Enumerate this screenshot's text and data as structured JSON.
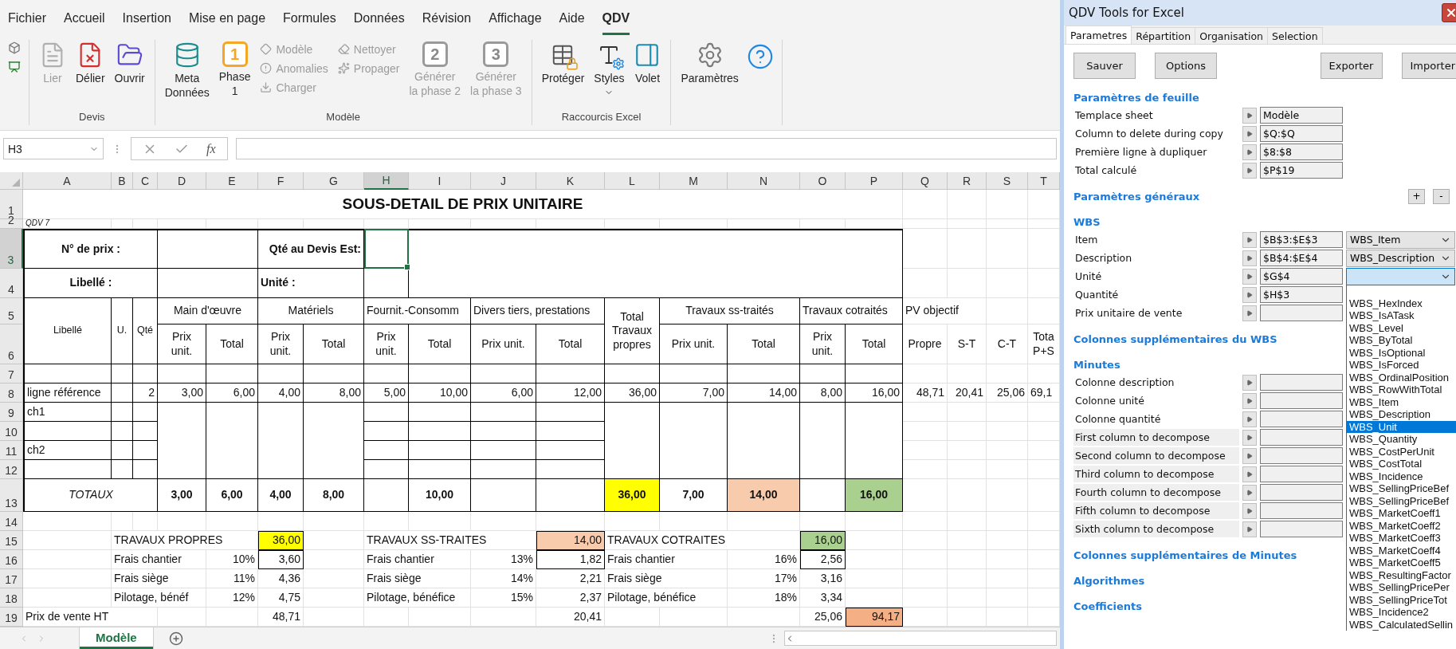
{
  "ribbon": {
    "tabs": [
      {
        "label": "Fichier",
        "selected": false
      },
      {
        "label": "Accueil",
        "selected": false
      },
      {
        "label": "Insertion",
        "selected": false
      },
      {
        "label": "Mise en page",
        "selected": false
      },
      {
        "label": "Formules",
        "selected": false
      },
      {
        "label": "Données",
        "selected": false
      },
      {
        "label": "Révision",
        "selected": false
      },
      {
        "label": "Affichage",
        "selected": false
      },
      {
        "label": "Aide",
        "selected": false
      },
      {
        "label": "QDV",
        "selected": true
      }
    ],
    "groups": [
      {
        "buttons": [
          {
            "kind": "tiny"
          },
          {
            "kind": "tiny"
          }
        ]
      },
      {
        "label": "Devis",
        "buttons": [
          {
            "kind": "large",
            "label": "Lier",
            "disabled": true
          },
          {
            "kind": "large",
            "label": "Délier",
            "disabled": false
          },
          {
            "kind": "large",
            "label": "Ouvrir",
            "disabled": false
          }
        ]
      },
      {
        "label": "Modèle",
        "buttons": [
          {
            "kind": "large",
            "label": "Meta\nDonnées",
            "disabled": false
          },
          {
            "kind": "numbered",
            "badge": "1",
            "label": "Phase\n1",
            "disabled": false
          },
          {
            "kind": "stack",
            "items": [
              {
                "label": "Modèle",
                "disabled": true
              },
              {
                "label": "Anomalies",
                "disabled": true
              },
              {
                "label": "Charger",
                "disabled": true
              }
            ]
          },
          {
            "kind": "stack",
            "items": [
              {
                "label": "Nettoyer",
                "disabled": true
              },
              {
                "label": "Propager",
                "disabled": true
              }
            ]
          },
          {
            "kind": "numbered",
            "badge": "2",
            "label": "Générer\nla phase 2",
            "disabled": true
          },
          {
            "kind": "numbered",
            "badge": "3",
            "label": "Générer\nla phase 3",
            "disabled": true
          }
        ]
      },
      {
        "label": "Raccourcis Excel",
        "buttons": [
          {
            "kind": "large",
            "label": "Protéger",
            "disabled": false
          },
          {
            "kind": "menu",
            "label": "Styles",
            "disabled": false
          },
          {
            "kind": "large",
            "label": "Volet",
            "disabled": false
          }
        ]
      },
      {
        "buttons": [
          {
            "kind": "large",
            "label": "Paramètres",
            "disabled": false
          },
          {
            "kind": "icon",
            "disabled": false
          }
        ]
      }
    ]
  },
  "formula_bar": {
    "name_box": "H3",
    "function_label": "fx"
  },
  "sheet": {
    "columns": [
      {
        "label": "A",
        "selected": false
      },
      {
        "label": "B",
        "selected": false
      },
      {
        "label": "C",
        "selected": false
      },
      {
        "label": "D",
        "selected": false
      },
      {
        "label": "E",
        "selected": false
      },
      {
        "label": "F",
        "selected": false
      },
      {
        "label": "G",
        "selected": false
      },
      {
        "label": "H",
        "selected": true
      },
      {
        "label": "I",
        "selected": false
      },
      {
        "label": "J",
        "selected": false
      },
      {
        "label": "K",
        "selected": false
      },
      {
        "label": "L",
        "selected": false
      },
      {
        "label": "M",
        "selected": false
      },
      {
        "label": "N",
        "selected": false
      },
      {
        "label": "O",
        "selected": false
      },
      {
        "label": "P",
        "selected": false
      },
      {
        "label": "Q",
        "selected": false
      },
      {
        "label": "R",
        "selected": false
      },
      {
        "label": "S",
        "selected": false
      },
      {
        "label": "T",
        "selected": false
      }
    ],
    "rows": [
      {
        "label": "1",
        "selected": false,
        "cells": [
          {
            "text": "SOUS-DETAIL DE PRIX UNITAIRE"
          }
        ]
      },
      {
        "label": "2",
        "selected": false,
        "cells": [
          {
            "text": "QDV 7"
          }
        ]
      },
      {
        "label": "3",
        "selected": true,
        "cells": [
          {
            "text": "N° de prix :"
          },
          {
            "text": "Qté au Devis Est:"
          }
        ]
      },
      {
        "label": "4",
        "selected": false,
        "cells": [
          {
            "text": "Libellé :"
          },
          {
            "text": "Unité :"
          }
        ]
      },
      {
        "label": "5",
        "selected": false,
        "cells": [
          {
            "text": "Libellé"
          },
          {
            "text": "U."
          },
          {
            "text": "Qté"
          },
          {
            "text": "Main d'œuvre"
          },
          {
            "text": "Matériels"
          },
          {
            "text": "Fournit.-Consomm"
          },
          {
            "text": "Divers tiers, prestations"
          },
          {
            "text": "Total Travaux propres"
          },
          {
            "text": "Travaux ss-traités"
          },
          {
            "text": "Travaux cotraités"
          },
          {
            "text": "PV objectif"
          }
        ]
      },
      {
        "label": "6",
        "selected": false,
        "cells": [
          {
            "text": "Prix unit."
          },
          {
            "text": "Total"
          },
          {
            "text": "Prix unit."
          },
          {
            "text": "Total"
          },
          {
            "text": "Prix unit."
          },
          {
            "text": "Total"
          },
          {
            "text": "Prix unit."
          },
          {
            "text": "Total"
          },
          {
            "text": "Prix unit."
          },
          {
            "text": "Total"
          },
          {
            "text": "Prix unit."
          },
          {
            "text": "Total"
          },
          {
            "text": "Propre"
          },
          {
            "text": "S-T"
          },
          {
            "text": "C-T"
          },
          {
            "text": "Tota P+S"
          }
        ]
      },
      {
        "label": "7",
        "selected": false
      },
      {
        "label": "8",
        "selected": false,
        "cells": [
          {
            "text": "ligne référence"
          },
          {
            "text": "2"
          },
          {
            "text": "3,00"
          },
          {
            "text": "6,00"
          },
          {
            "text": "4,00"
          },
          {
            "text": "8,00"
          },
          {
            "text": "5,00"
          },
          {
            "text": "10,00"
          },
          {
            "text": "6,00"
          },
          {
            "text": "12,00"
          },
          {
            "text": "36,00"
          },
          {
            "text": "7,00"
          },
          {
            "text": "14,00"
          },
          {
            "text": "8,00"
          },
          {
            "text": "16,00"
          },
          {
            "text": "48,71"
          },
          {
            "text": "20,41"
          },
          {
            "text": "25,06"
          },
          {
            "text": "69,1"
          }
        ]
      },
      {
        "label": "9",
        "selected": false,
        "cells": [
          {
            "text": "ch1"
          }
        ]
      },
      {
        "label": "10",
        "selected": false
      },
      {
        "label": "11",
        "selected": false,
        "cells": [
          {
            "text": "ch2"
          }
        ]
      },
      {
        "label": "12",
        "selected": false
      },
      {
        "label": "13",
        "selected": false,
        "cells": [
          {
            "text": "TOTAUX"
          },
          {
            "text": "3,00"
          },
          {
            "text": "6,00"
          },
          {
            "text": "4,00"
          },
          {
            "text": "8,00"
          },
          {
            "text": "10,00"
          },
          {
            "text": "36,00",
            "color": "#ffff00"
          },
          {
            "text": "7,00"
          },
          {
            "text": "14,00",
            "color": "#f8cbad"
          },
          {
            "text": "16,00",
            "color": "#a9d08e"
          }
        ]
      },
      {
        "label": "14",
        "selected": false
      },
      {
        "label": "15",
        "selected": false,
        "cells": [
          {
            "text": "TRAVAUX PROPRES"
          },
          {
            "text": "36,00",
            "color": "#ffff00"
          },
          {
            "text": "TRAVAUX SS-TRAITES"
          },
          {
            "text": "14,00",
            "color": "#f8cbad"
          },
          {
            "text": "TRAVAUX COTRAITES"
          },
          {
            "text": "16,00",
            "color": "#a9d08e"
          }
        ]
      },
      {
        "label": "16",
        "selected": false,
        "cells": [
          {
            "text": "Frais chantier"
          },
          {
            "text": "10%"
          },
          {
            "text": "3,60"
          },
          {
            "text": "Frais chantier"
          },
          {
            "text": "13%"
          },
          {
            "text": "1,82"
          },
          {
            "text": "Frais chantier"
          },
          {
            "text": "16%"
          },
          {
            "text": "2,56"
          }
        ]
      },
      {
        "label": "17",
        "selected": false,
        "cells": [
          {
            "text": "Frais siège"
          },
          {
            "text": "11%"
          },
          {
            "text": "4,36"
          },
          {
            "text": "Frais siège"
          },
          {
            "text": "14%"
          },
          {
            "text": "2,21"
          },
          {
            "text": "Frais siège"
          },
          {
            "text": "17%"
          },
          {
            "text": "3,16"
          }
        ]
      },
      {
        "label": "18",
        "selected": false,
        "cells": [
          {
            "text": "Pilotage, bénéf"
          },
          {
            "text": "12%"
          },
          {
            "text": "4,75"
          },
          {
            "text": "Pilotage, bénéfice"
          },
          {
            "text": "15%"
          },
          {
            "text": "2,37"
          },
          {
            "text": "Pilotage, bénéfice"
          },
          {
            "text": "18%"
          },
          {
            "text": "3,34"
          }
        ]
      },
      {
        "label": "19",
        "selected": false,
        "cells": [
          {
            "text": "Prix de vente HT"
          },
          {
            "text": "48,71"
          },
          {
            "text": "20,41"
          },
          {
            "text": "25,06"
          },
          {
            "text": "94,17",
            "color": "#f4b084"
          }
        ]
      }
    ]
  },
  "sheet_tabs": [
    {
      "label": "Modèle",
      "selected": true
    }
  ],
  "panel": {
    "title": "QDV Tools for Excel",
    "tabs": [
      {
        "label": "Parametres",
        "selected": true
      },
      {
        "label": "Répartition",
        "selected": false
      },
      {
        "label": "Organisation",
        "selected": false
      },
      {
        "label": "Selection",
        "selected": false
      }
    ],
    "actions": [
      "Sauver",
      "Options",
      "Exporter",
      "Importer"
    ],
    "sections": [
      {
        "title": "Paramètres de feuille",
        "rows": [
          {
            "kind": "plain",
            "label": "Templace sheet",
            "value": "Modèle"
          },
          {
            "kind": "plain",
            "label": "Column to delete during copy",
            "value": "$Q:$Q"
          },
          {
            "kind": "plain",
            "label": "Première ligne à dupliquer",
            "value": "$8:$8"
          },
          {
            "kind": "plain",
            "label": "Total calculé",
            "value": "$P$19"
          }
        ]
      },
      {
        "title": "Paramètres généraux",
        "buttons": [
          "+",
          "-"
        ]
      },
      {
        "title": "WBS",
        "rows": [
          {
            "kind": "plain",
            "label": "Item",
            "value": "$B$3:$E$3",
            "combo": {
              "value": "WBS_Item",
              "open": false
            }
          },
          {
            "kind": "plain",
            "label": "Description",
            "value": "$B$4:$E$4",
            "combo": {
              "value": "WBS_Description",
              "open": false
            }
          },
          {
            "kind": "plain",
            "label": "Unité",
            "value": "$G$4",
            "combo": {
              "open": true,
              "options": [
                {
                  "label": "WBS_HexIndex",
                  "selected": false
                },
                {
                  "label": "WBS_IsATask",
                  "selected": false
                },
                {
                  "label": "WBS_Level",
                  "selected": false
                },
                {
                  "label": "WBS_ByTotal",
                  "selected": false
                },
                {
                  "label": "WBS_IsOptional",
                  "selected": false
                },
                {
                  "label": "WBS_IsForced",
                  "selected": false
                },
                {
                  "label": "WBS_OrdinalPosition",
                  "selected": false
                },
                {
                  "label": "WBS_RowWithTotal",
                  "selected": false
                },
                {
                  "label": "WBS_Item",
                  "selected": false
                },
                {
                  "label": "WBS_Description",
                  "selected": false
                },
                {
                  "label": "WBS_Unit",
                  "selected": true
                },
                {
                  "label": "WBS_Quantity",
                  "selected": false
                },
                {
                  "label": "WBS_CostPerUnit",
                  "selected": false
                },
                {
                  "label": "WBS_CostTotal",
                  "selected": false
                },
                {
                  "label": "WBS_Incidence",
                  "selected": false
                },
                {
                  "label": "WBS_SellingPriceBef",
                  "selected": false
                },
                {
                  "label": "WBS_SellingPriceBef",
                  "selected": false
                },
                {
                  "label": "WBS_MarketCoeff1",
                  "selected": false
                },
                {
                  "label": "WBS_MarketCoeff2",
                  "selected": false
                },
                {
                  "label": "WBS_MarketCoeff3",
                  "selected": false
                },
                {
                  "label": "WBS_MarketCoeff4",
                  "selected": false
                },
                {
                  "label": "WBS_MarketCoeff5",
                  "selected": false
                },
                {
                  "label": "WBS_ResultingFactor",
                  "selected": false
                },
                {
                  "label": "WBS_SellingPricePer",
                  "selected": false
                },
                {
                  "label": "WBS_SellingPriceTot",
                  "selected": false
                },
                {
                  "label": "WBS_Incidence2",
                  "selected": false
                },
                {
                  "label": "WBS_CalculatedSellin",
                  "selected": false
                }
              ]
            }
          },
          {
            "kind": "plain",
            "label": "Quantité",
            "value": "$H$3"
          },
          {
            "kind": "plain",
            "label": "Prix unitaire de vente"
          }
        ]
      },
      {
        "title": "Colonnes supplémentaires du WBS"
      },
      {
        "title": "Minutes",
        "rows": [
          {
            "kind": "plain",
            "label": "Colonne description"
          },
          {
            "kind": "plain",
            "label": "Colonne unité"
          },
          {
            "kind": "plain",
            "label": "Colonne quantité"
          },
          {
            "kind": "shaded",
            "label": "First column to decompose"
          },
          {
            "kind": "shaded",
            "label": "Second column to decompose"
          },
          {
            "kind": "shaded",
            "label": "Third column to decompose"
          },
          {
            "kind": "shaded",
            "label": "Fourth column to decompose"
          },
          {
            "kind": "shaded",
            "label": "Fifth column to decompose"
          },
          {
            "kind": "shaded",
            "label": "Sixth column to decompose"
          }
        ]
      },
      {
        "title": "Colonnes supplémentaires de Minutes"
      },
      {
        "title": "Algorithmes"
      },
      {
        "title": "Coefficients"
      }
    ]
  }
}
